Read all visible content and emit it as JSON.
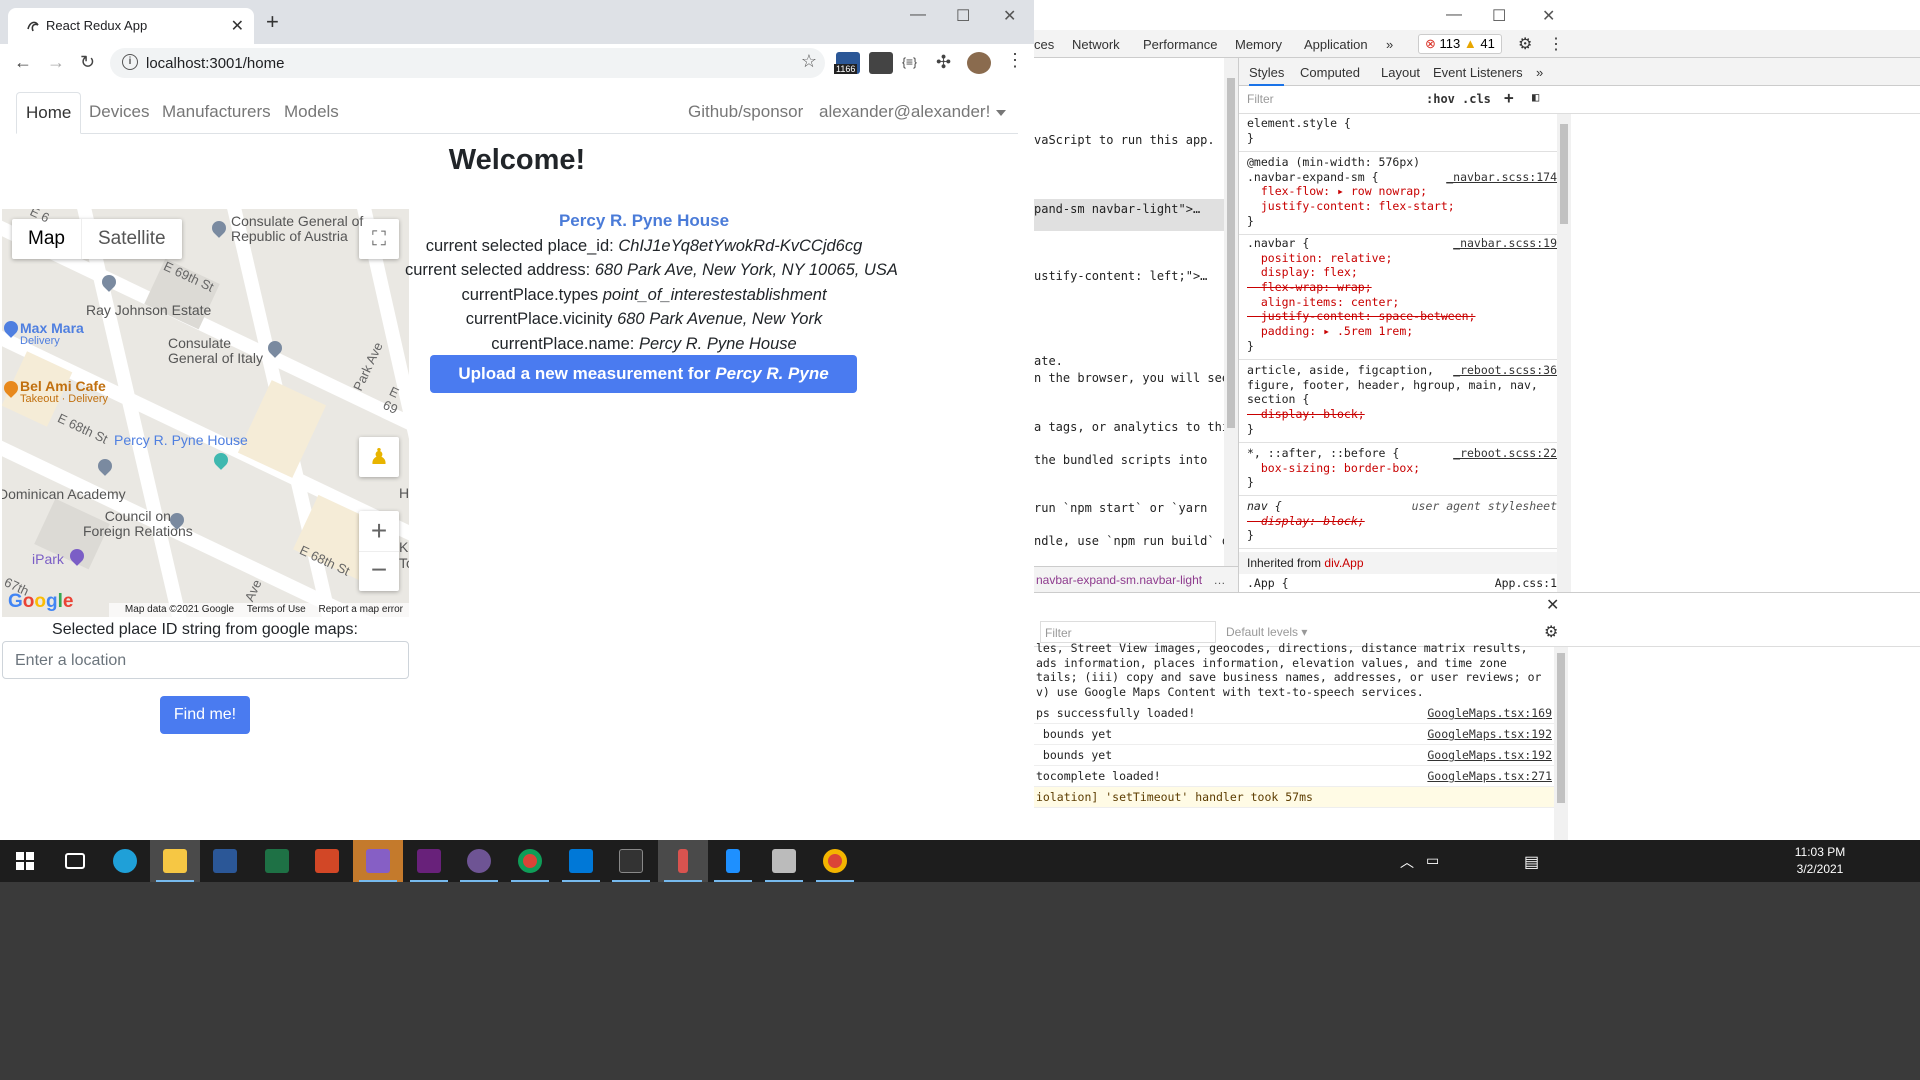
{
  "browser": {
    "tab_title": "React Redux App",
    "tab_close": "✕",
    "new_tab": "+",
    "url": "localhost:3001/home",
    "ext_badge": "1166",
    "ext_braces": "{≡}",
    "win_minimize": "—",
    "win_maximize": "☐",
    "win_close": "✕"
  },
  "navbar": {
    "items": [
      {
        "label": "Home",
        "active": true
      },
      {
        "label": "Devices"
      },
      {
        "label": "Manufacturers"
      },
      {
        "label": "Models"
      }
    ],
    "right": [
      {
        "label": "Github/sponsor"
      },
      {
        "label": "alexander@alexander!"
      }
    ]
  },
  "welcome": "Welcome!",
  "map": {
    "type_map": "Map",
    "type_satellite": "Satellite",
    "labels": {
      "consulate_austria": "Consulate General of\nRepublic of Austria",
      "ray_johnson": "Ray Johnson Estate",
      "max_mara": "Max Mara",
      "max_mara_sub": "Delivery",
      "consulate_italy": "Consulate\nGeneral of Italy",
      "bel_ami": "Bel Ami Cafe",
      "bel_ami_sub": "Takeout · Delivery",
      "percy": "Percy R. Pyne House",
      "dominican": "Dominican Academy",
      "council": "Council on\nForeign Relations",
      "ipark": "iPark",
      "e69_1": "E 69th St",
      "e68_1": "E 68th St",
      "e68_2": "E 68th St",
      "park_ave": "Park Ave",
      "e69_2": "E 69",
      "ave": "Ave",
      "h": "H",
      "ka": "Ka",
      "to": "To",
      "e_left": "E 6",
      "st67": "67th"
    },
    "google": "Google",
    "footer": {
      "data": "Map data ©2021 Google",
      "terms": "Terms of Use",
      "report": "Report a map error"
    }
  },
  "place": {
    "name": "Percy R. Pyne House",
    "place_id_label": "current selected place_id:",
    "place_id": "ChIJ1eYq8etYwokRd-KvCCjd6cg",
    "address_label": "current selected address:",
    "address": "680 Park Ave, New York, NY 10065, USA",
    "types_label": "currentPlace.types",
    "types": "point_of_interestestablishment",
    "vicinity_label": "currentPlace.vicinity",
    "vicinity": "680 Park Avenue, New York",
    "name_label": "currentPlace.name:",
    "upload_prefix": "Upload a new measurement for",
    "upload_name": "Percy R. Pyne House"
  },
  "place_id_prompt": "Selected place ID string from google maps:",
  "location_placeholder": "Enter a location",
  "find_button": "Find me!",
  "devtools": {
    "tabs": [
      "ces",
      "Network",
      "Performance",
      "Memory",
      "Application",
      "»"
    ],
    "errors": "113",
    "warnings": "41",
    "elements_lines": [
      "vaScript to run this app.",
      "pand-sm navbar-light\">…",
      "ustify-content: left;\">…",
      "ate.",
      "n the browser, you will see",
      "a tags, or analytics to this",
      "the bundled scripts into",
      "run `npm start` or `yarn",
      "ndle, use `npm run build` or"
    ],
    "crumb": "navbar-expand-sm.navbar-light",
    "crumb_more": "…",
    "styles_tabs": [
      "Styles",
      "Computed",
      "Layout",
      "Event Listeners",
      "»"
    ],
    "filter_placeholder": "Filter",
    "hov": ":hov",
    "cls": ".cls",
    "plus": "+",
    "rules": [
      {
        "lines": [
          "element.style {",
          "}"
        ]
      },
      {
        "lines": [
          "@media (min-width: 576px)",
          ".navbar-expand-sm {",
          "  flex-flow: ▸ row nowrap;",
          "  justify-content: flex-start;",
          "}"
        ],
        "src": "_navbar.scss:174"
      },
      {
        "lines": [
          ".navbar {",
          "  position: relative;",
          "  display: flex;",
          "  flex-wrap: wrap;",
          "  align-items: center;",
          "  justify-content: space-between;",
          "  padding: ▸ .5rem 1rem;",
          "}"
        ],
        "src": "_navbar.scss:19"
      },
      {
        "lines": [
          "article, aside, figcaption,",
          "figure, footer, header, hgroup, main, nav,",
          "section {",
          "  display: block;",
          "}"
        ],
        "src": "_reboot.scss:36"
      },
      {
        "lines": [
          "*, ::after, ::before {",
          "  box-sizing: border-box;",
          "}"
        ],
        "src": "_reboot.scss:22"
      },
      {
        "lines": [
          "nav {",
          "  display: block;",
          "}"
        ],
        "src": "user agent stylesheet"
      }
    ],
    "inherited_label": "Inherited from",
    "inherited_from": "div.App",
    "app_rule": ".App {",
    "app_src": "App.css:1",
    "console_filter": "Filter",
    "default_levels": "Default levels ▾",
    "console_block": "les, Street View images, geocodes, directions, distance matrix results,\nads information, places information, elevation values, and time zone\ntails; (iii) copy and save business names, addresses, or user reviews; or\nv) use Google Maps Content with text-to-speech services.",
    "console_lines": [
      {
        "text": "ps successfully loaded!",
        "src": "GoogleMaps.tsx:169"
      },
      {
        "text": " bounds yet",
        "src": "GoogleMaps.tsx:192"
      },
      {
        "text": " bounds yet",
        "src": "GoogleMaps.tsx:192"
      },
      {
        "text": "tocomplete loaded!",
        "src": "GoogleMaps.tsx:271"
      },
      {
        "text": "iolation] 'setTimeout' handler took 57ms",
        "src": "",
        "warn": true
      }
    ]
  },
  "taskbar": {
    "time": "11:03 PM",
    "date": "3/2/2021"
  }
}
